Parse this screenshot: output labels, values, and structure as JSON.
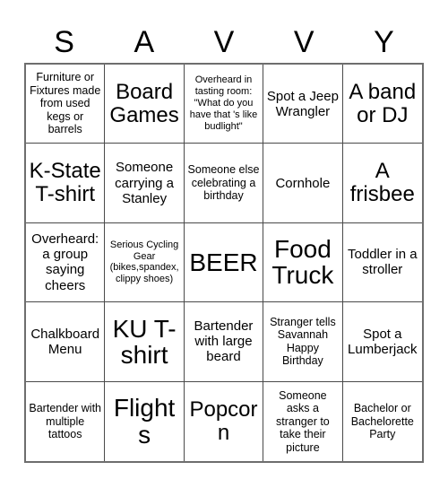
{
  "card": {
    "title_letters": [
      "S",
      "A",
      "V",
      "V",
      "Y"
    ],
    "colors": {
      "background": "#ffffff",
      "text": "#000000",
      "grid_line": "#4a4a4a",
      "outer_border": "#6e6e6e"
    },
    "rows": [
      [
        {
          "text": "Furniture or Fixtures made from used kegs or barrels",
          "size": "fs-sm"
        },
        {
          "text": "Board Games",
          "size": "fs-xl"
        },
        {
          "text": "Overheard in tasting room: \"What do you have that 's like budlight\"",
          "size": "fs-xs"
        },
        {
          "text": "Spot a Jeep Wrangler",
          "size": "fs-md"
        },
        {
          "text": "A band or DJ",
          "size": "fs-xl"
        }
      ],
      [
        {
          "text": "K-State T-shirt",
          "size": "fs-xl"
        },
        {
          "text": "Someone carrying a Stanley",
          "size": "fs-md"
        },
        {
          "text": "Someone else celebrating a birthday",
          "size": "fs-sm"
        },
        {
          "text": "Cornhole",
          "size": "fs-md"
        },
        {
          "text": "A frisbee",
          "size": "fs-xl"
        }
      ],
      [
        {
          "text": "Overheard: a group saying cheers",
          "size": "fs-md"
        },
        {
          "text": "Serious Cycling Gear (bikes,spandex, clippy shoes)",
          "size": "fs-xs"
        },
        {
          "text": "BEER",
          "size": "fs-xxl"
        },
        {
          "text": "Food Truck",
          "size": "fs-xxl"
        },
        {
          "text": "Toddler in a stroller",
          "size": "fs-md"
        }
      ],
      [
        {
          "text": "Chalkboard Menu",
          "size": "fs-md"
        },
        {
          "text": "KU T-shirt",
          "size": "fs-xxl"
        },
        {
          "text": "Bartender with large beard",
          "size": "fs-md"
        },
        {
          "text": "Stranger tells Savannah Happy Birthday",
          "size": "fs-sm"
        },
        {
          "text": "Spot a Lumberjack",
          "size": "fs-md"
        }
      ],
      [
        {
          "text": "Bartender with multiple tattoos",
          "size": "fs-sm"
        },
        {
          "text": "Flights",
          "size": "fs-xxl"
        },
        {
          "text": "Popcorn",
          "size": "fs-xl"
        },
        {
          "text": "Someone asks a stranger to take their picture",
          "size": "fs-sm"
        },
        {
          "text": "Bachelor or Bachelorette Party",
          "size": "fs-sm"
        }
      ]
    ]
  }
}
